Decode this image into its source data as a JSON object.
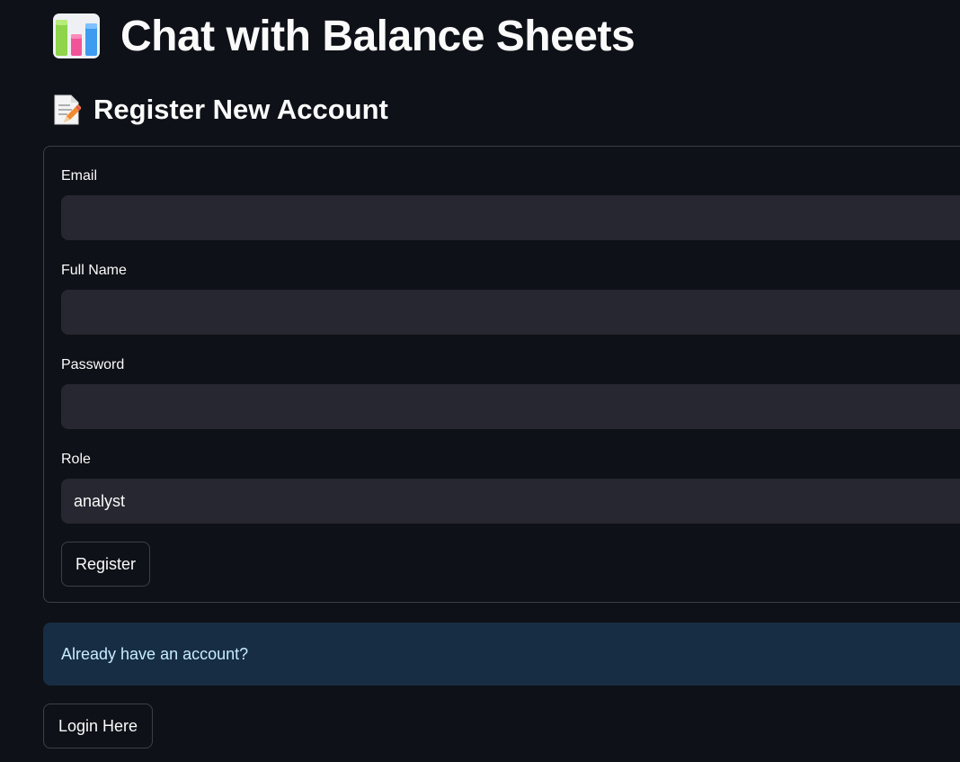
{
  "header": {
    "icon": "bar-chart-icon",
    "title": "Chat with Balance Sheets"
  },
  "register": {
    "icon": "memo-icon",
    "heading": "Register New Account",
    "fields": {
      "email": {
        "label": "Email",
        "value": ""
      },
      "full_name": {
        "label": "Full Name",
        "value": ""
      },
      "password": {
        "label": "Password",
        "value": ""
      },
      "role": {
        "label": "Role",
        "value": "analyst"
      }
    },
    "submit_label": "Register"
  },
  "login_prompt": {
    "info_text": "Already have an account?",
    "button_label": "Login Here"
  },
  "colors": {
    "background": "#0e1117",
    "input_bg": "#262730",
    "info_bg": "#172d43",
    "info_text": "#c7ebff"
  }
}
